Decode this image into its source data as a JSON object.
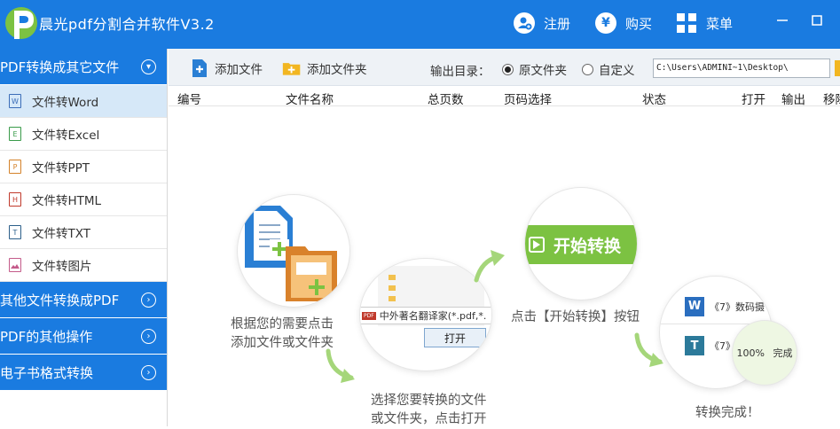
{
  "app": {
    "title": "晨光pdf分割合并软件V3.2"
  },
  "titlebar": {
    "register_label": "注册",
    "buy_label": "购买",
    "menu_label": "菜单"
  },
  "sidebar": {
    "categories": [
      {
        "label": "PDF转换成其它文件"
      },
      {
        "label": "其他文件转换成PDF"
      },
      {
        "label": "PDF的其他操作"
      },
      {
        "label": "电子书格式转换"
      }
    ],
    "items": [
      {
        "label": "文件转Word",
        "icon_letter": "W"
      },
      {
        "label": "文件转Excel",
        "icon_letter": "E"
      },
      {
        "label": "文件转PPT",
        "icon_letter": "P"
      },
      {
        "label": "文件转HTML",
        "icon_letter": "H"
      },
      {
        "label": "文件转TXT",
        "icon_letter": "T"
      },
      {
        "label": "文件转图片",
        "icon_letter": ""
      }
    ]
  },
  "toolbar": {
    "add_file_label": "添加文件",
    "add_folder_label": "添加文件夹",
    "output_dir_label": "输出目录：",
    "radio_original": "原文件夹",
    "radio_custom": "自定义",
    "path_value": "C:\\Users\\ADMINI~1\\Desktop\\"
  },
  "table": {
    "headers": [
      "编号",
      "文件名称",
      "总页数",
      "页码选择",
      "状态",
      "打开",
      "输出",
      "移除"
    ]
  },
  "guide": {
    "step1_line1": "根据您的需要点击",
    "step1_line2": "添加文件或文件夹",
    "step2_line1": "选择您要转换的文件",
    "step2_line2": "或文件夹，点击打开",
    "step2_filename": "中外著名翻译家(*.pdf,*.",
    "step2_open_button": "打开",
    "step2_badge": "PDF",
    "step3_text": "点击【开始转换】按钮",
    "step3_button": "开始转换",
    "step4_text": "转换完成！",
    "step4_item1": "《7》数码摄",
    "step4_item2": "《7》",
    "step4_progress": "100%",
    "step4_done": "完成"
  },
  "colors": {
    "brand_blue": "#1a7be0",
    "active_item": "#d6e8f8",
    "green": "#7cc242",
    "folder_yellow": "#f2b621"
  }
}
